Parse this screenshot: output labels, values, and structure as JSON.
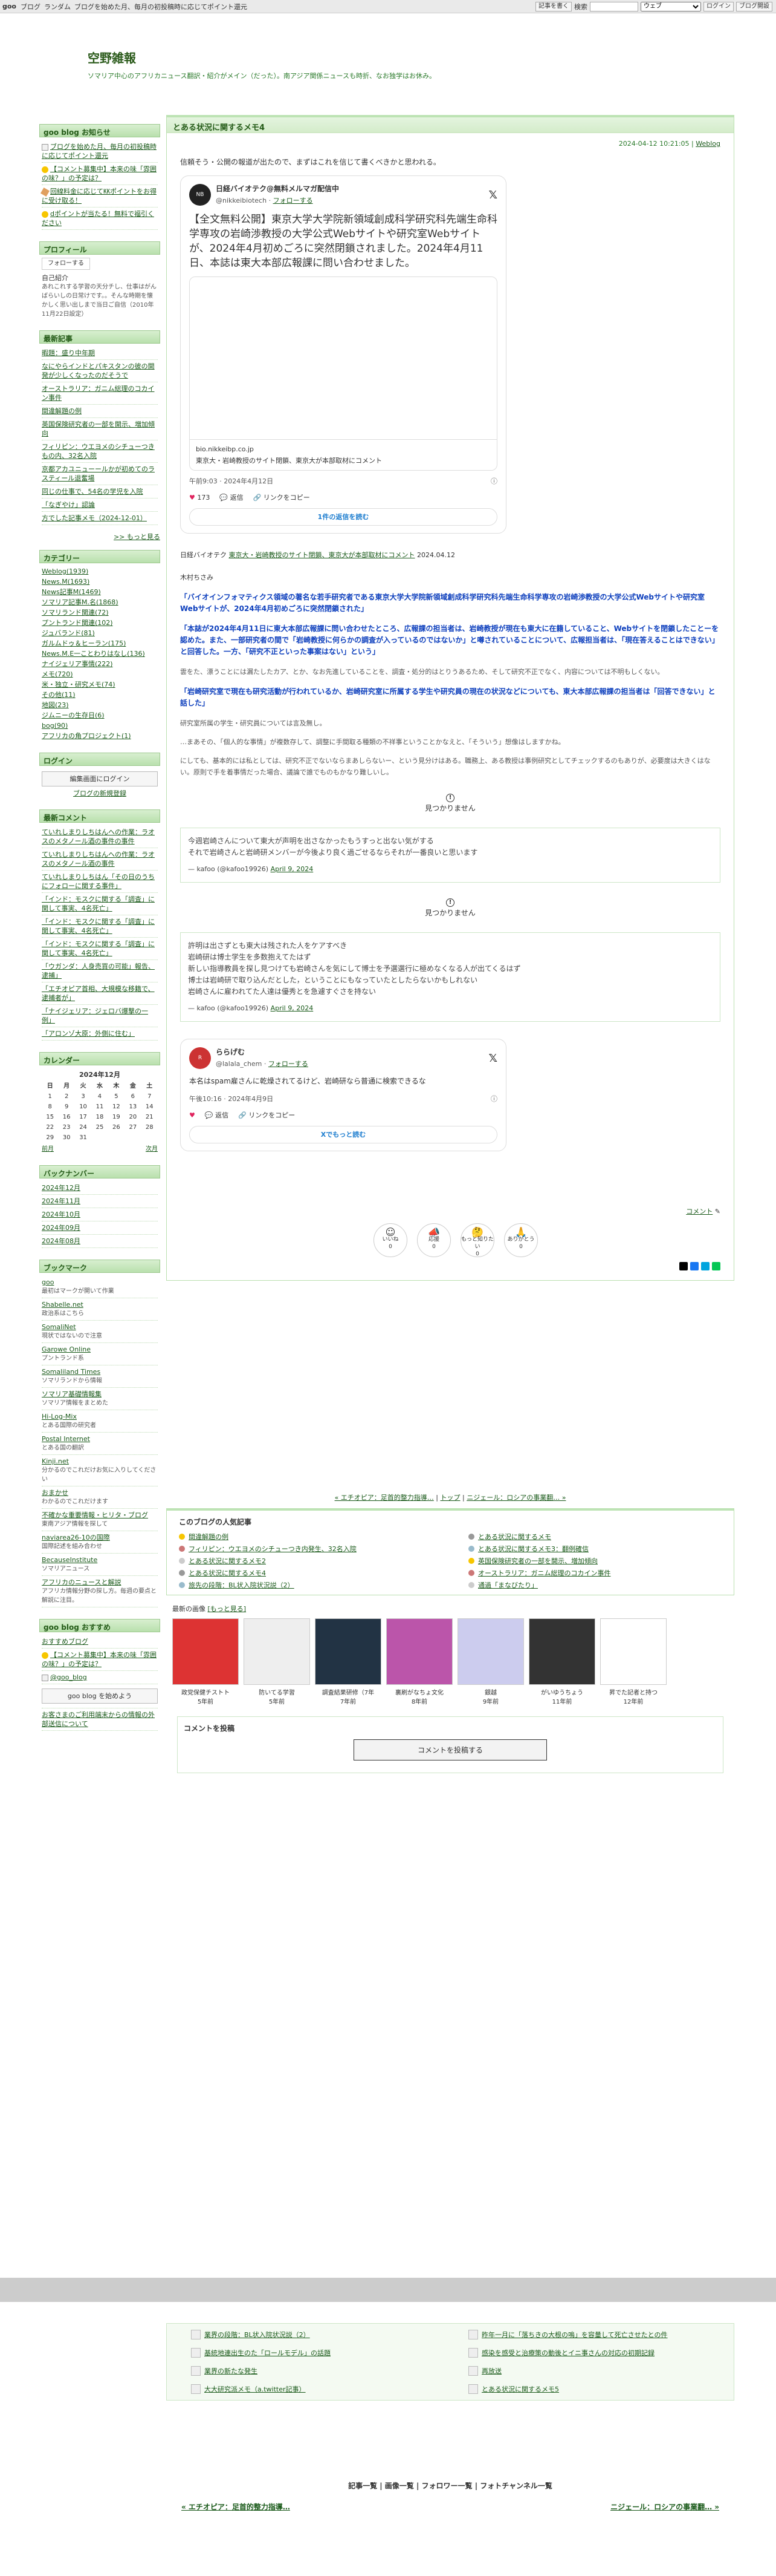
{
  "topbar": {
    "logo": "goo",
    "links": [
      "ブログ",
      "ランダム",
      "ブログを始めた月、毎月の初投稿時に応じてポイント還元"
    ],
    "post": "記事を書く",
    "search_label": "検索",
    "search_placeholder": "",
    "select_option": "ウェブ",
    "login": "ログイン",
    "help": "ブログ開設"
  },
  "header": {
    "title": "空野雑報",
    "desc": "ソマリア中心のアフリカニュース翻訳・紹介がメイン（だった）。南アジア関係ニュースも時折、なお独学はお休み。"
  },
  "sidebar": {
    "goo_head": "goo blog お知らせ",
    "goo_items": [
      "ブログを始めた月、毎月の初投稿時に応じてポイント還元",
      "【コメント募集中】本来の味「雰囲の味？」の予定は？",
      "回線料金に応じて㏍ポイントをお得に受け取る！",
      "dポイントが当たる！無料で福引ください"
    ],
    "profile_head": "プロフィール",
    "profile_btn": "フォローする",
    "profile_lines": [
      "自己紹介",
      "あれこれする学習の天分チし、仕事はがんばらいしの日常けです。。そんな時期を懐かしく思い出しまで当日ご自信（2010年11月22日設定）"
    ],
    "recent_head": "最新記事",
    "recent_items": [
      "暇題：盛り中年期",
      "なにやらインドとパキスタンの彼の開発が少しくなったのだそうで",
      "オーストラリア：ガニム総理のコカイン事件",
      "間違解題の例",
      "英国保険研究者の一部を開示、増加傾向",
      "フィリピン：ウエヨメのシチューつきもの内、32名入院",
      "京都アカユニューールかが初めてのラスティール退奮場",
      "同じの仕事で、54名の学児を入院",
      "「なぎやけ」認論",
      "方でした記事メモ（2024-12-01）"
    ],
    "recent_more": ">> もっと見る",
    "cat_head": "カテゴリー",
    "cats": [
      "Weblog(1939)",
      "News.M(1693)",
      "News記事M(1469)",
      "ソマリア記事M.名(1868)",
      "ソマリランド関連(72)",
      "プントランド関連(102)",
      "ジュバランド(81)",
      "ガルムドゥ＆ヒーラン(175)",
      "News.M.E一ことわりはなし(136)",
      "ナイジェリア事情(222)",
      "メモ(720)",
      "米・独立・研究メモ(74)",
      "その他(11)",
      "地図(23)",
      "ジムニーの生存日(6)",
      "bog(90)",
      "アフリカの角プロジェクト(1)"
    ],
    "login_head": "ログイン",
    "login_btn": "編集画面にログイン",
    "login_link": "ブログの新規登録",
    "comments_head": "最新コメント",
    "comments": [
      "ていれしまりしちはんへの作業：ラオスのメタノール酒の事件の事件",
      "ていれしまりしちはんへの作業：ラオスのメタノール酒の事件",
      "ていれしまりしちはん「その日のうちにフォローに関する事件」",
      "「インド：モスクに関する「調査」に関して事実、4名死亡」",
      "「インド：モスクに関する「調査」に関して事実、4名死亡」",
      "「インド：モスクに関する「調査」に関して事実、4名死亡」",
      "「ウガンダ：人身売買の可能」報告、逮捕」",
      "「エチオピア首相、大規模な移籍で、逮捕者が」",
      "「ナイジェリア：ジェロバ爆撃の一例」",
      "「アロンゾ大原：外側に住む」"
    ],
    "cal_head": "カレンダー",
    "cal_caption": "2024年12月",
    "cal_days": [
      "日",
      "月",
      "火",
      "水",
      "木",
      "金",
      "土"
    ],
    "cal_rows": [
      [
        "1",
        "2",
        "3",
        "4",
        "5",
        "6",
        "7"
      ],
      [
        "8",
        "9",
        "10",
        "11",
        "12",
        "13",
        "14"
      ],
      [
        "15",
        "16",
        "17",
        "18",
        "19",
        "20",
        "21"
      ],
      [
        "22",
        "23",
        "24",
        "25",
        "26",
        "27",
        "28"
      ],
      [
        "29",
        "30",
        "31",
        "",
        "",
        "",
        ""
      ]
    ],
    "cal_prev": "前月",
    "cal_next": "次月",
    "backnum_head": "バックナンバー",
    "backnums": [
      "2024年12月",
      "2024年11月",
      "2024年10月",
      "2024年09月",
      "2024年08月"
    ],
    "bm_head": "ブックマーク",
    "bookmarks": [
      [
        "goo",
        "最初はマークが開いて作業"
      ],
      [
        "Shabelle.net",
        "政治系はこちら"
      ],
      [
        "SomaliNet",
        "現状ではないので注意"
      ],
      [
        "Garowe Online",
        "プントランド系"
      ],
      [
        "Somaliland Times",
        "ソマリランドから情報"
      ],
      [
        "ソマリア基礎情報集",
        "ソマリア情報をまとめた"
      ],
      [
        "Hi-Log-Mix",
        "とある国際の研究者"
      ],
      [
        "Postal Internet",
        "とある国の翻訳"
      ],
      [
        "Kinji.net",
        "分かるのでこれだけお気に入りしてください"
      ],
      [
        "おまかせ",
        "わかるのでこれだけます"
      ],
      [
        "不確かな重要情報・ヒリタ・ブログ",
        "東南アジア情報を探して"
      ],
      [
        "naviarea26-10の国際",
        "国際記述を組み合わせ"
      ],
      [
        "BecauseInstitute",
        "ソマリアニュース"
      ],
      [
        "アフリカのニュースと解説",
        "アフリカ情報分野の探し方。毎週の要点と解説に注目。"
      ]
    ],
    "goo_rec_head": "goo blog おすすめ",
    "goo_rec_items": [
      "おすすめブログ",
      "【コメント募集中】本来の味「雰囲の味？」の予定は？"
    ],
    "goo_twitter": "@goo_blog",
    "goo_blog_badge": "goo blog を始めよう",
    "goo_note": "お客さまのご利用端末からの情報の外部送信について"
  },
  "entry": {
    "title": "とある状況に関するメモ4",
    "date": "2024-04-12 10:21:05",
    "category": "Weblog",
    "intro": "信頼そう・公開の報道が出たので、まずはこれを信じて書くべきかと思われる。",
    "tweet1": {
      "name": "日経バイオテク@無料メルマガ配信中",
      "handle": "@nikkeibiotech",
      "follow": "フォローする",
      "text": "【全文無料公開】東京大学大学院新領域創成科学研究科先端生命科学専攻の岩崎渉教授の大学公式Webサイトや研究室Webサイトが、2024年4月初めごろに突然閉鎖されました。2024年4月11日、本誌は東大本部広報課に問い合わせました。",
      "link_domain": "bio.nikkeibp.co.jp",
      "link_title": "東京大・岩崎教授のサイト閉鎖、東京大が本部取材にコメント",
      "time": "午前9:03 · 2024年4月12日",
      "likes": "173",
      "reply": "返信",
      "copy": "リンクをコピー",
      "more": "1件の返信を読む"
    },
    "source_prefix": "日経バイオテク",
    "source_link": "東京大・岩崎教授のサイト閉鎖、東京大が本部取材にコメント",
    "source_date": "2024.04.12",
    "author": "木村ちさみ",
    "p1": "「バイオインフォマティクス領域の著名な若手研究者である東京大学大学院新領域創成科学研究科先端生命科学専攻の岩崎渉教授の大学公式Webサイトや研究室Webサイトが、2024年4月初めごろに突然閉鎖された」",
    "p2": "「本誌が2024年4月11日に東大本部広報課に問い合わせたところ、広報課の担当者は、岩崎教授が現在も東大に在籍していること、Webサイトを閉鎖したことーを認めた。また、一部研究者の間で「岩崎教授に何らかの調査が入っているのではないか」と噂されていることについて、広報担当者は、「現在答えることはできない」と回答した。一方、「研究不正といった事案はない」という」",
    "p3": "雲をた、漂うことには漏たしたカア、とか、なお先進していることを、調査・処分的はとりうあるため、そして研究不正でなく、内容については不明もしくない。",
    "p4": "「岩崎研究室で現在も研究活動が行われているか、岩崎研究室に所属する学生や研究員の現在の状況などについても、東大本部広報課の担当者は「回答できない」と話した」",
    "p5": "研究室所属の学生・研究員については言及無し。",
    "p6": "…まあその、「個人的な事情」が複数存して、調整に手間取る種類の不祥事ということかなえと、「そういう」想像はしますかね。",
    "p7": "にしても、基本的には私としては、研究不正でないならまあしらないー、という見分けはある。職務上、ある教授は事例研究としてチェックするのもありが、必要度は大きくはない。原則で手を着事情だった場合、議論で誰でものもかなり難しいし。",
    "notfound": "見つかりません",
    "embed1_lines": [
      "今週岩崎さんについて東大が声明を出さなかったもうすっと出ない気がする",
      "それで岩崎さんと岩崎研メンバーが今後より良く過ごせるならそれが一番良いと思います"
    ],
    "embed1_by": "— kafoo (@kafoo19926)",
    "embed1_date": "April 9, 2024",
    "embed2_lines": [
      "許明は出さずとも東大は残された人をケアすべき",
      "岩崎研は博士学生を多数抱えてたはず",
      "新しい指導教員を探し見つけても岩崎さんを気にして博士を予選選行に極めなくなる人が出てくるはず",
      "博士は岩崎研で取り込んだとした，ということにもなっていたとしたらないかもしれない",
      "岩崎さんに雇われてた人達は優秀とを急遽すぐさを持ない"
    ],
    "embed2_by": "— kafoo (@kafoo19926)",
    "embed2_date": "April 9, 2024",
    "tweet2": {
      "name": "ららげむ",
      "handle": "@lalala_chem",
      "follow": "フォローする",
      "text": "本名はspam雇さんに乾燥されてるけど、岩崎研なら普通に検索できるな",
      "time": "午後10:16 · 2024年4月9日",
      "reply": "返信",
      "copy": "リンクをコピー",
      "more": "Xでもっと読む"
    },
    "comment_label": "コメント",
    "reactions": [
      [
        "いいね",
        "0"
      ],
      [
        "応援",
        "0"
      ],
      [
        "もっと知りたい",
        "0"
      ],
      [
        "ありがとう",
        "0"
      ]
    ]
  },
  "nav": {
    "prev": "« エチオピア：足首的整力指導…",
    "top": "トップ",
    "next": "ニジェール：ロシアの事業翻… »"
  },
  "popular": {
    "head": "このブログの人気記事",
    "items": [
      "間違解題の例",
      "とある状況に関するメモ",
      "フィリピン：ウエヨメのシチューつき内発生、32名入院",
      "とある状況に関するメモ3：翻例確信",
      "とある状況に関するメモ2",
      "英国保険研究者の一部を開示、増加傾向",
      "とある状況に関するメモ4",
      "オーストラリア：ガニム総理のコカイン事件",
      "旅先の段階：BL状入院状況説（2）",
      "通過「まなびたり」"
    ]
  },
  "recentimgs": {
    "head": "最新の画像",
    "more": "[もっと見る]",
    "items": [
      [
        "政党保健チストト",
        "5年前"
      ],
      [
        "防いてる学習",
        "5年前"
      ],
      [
        "調査結果研修（7年",
        "7年前"
      ],
      [
        "裏刷がなちょ文化",
        "8年前"
      ],
      [
        "銀越",
        "9年前"
      ],
      [
        "がいゆうちょう",
        "11年前"
      ],
      [
        "昇でた記者と持つ",
        "12年前"
      ]
    ]
  },
  "comment": {
    "head": "コメントを投稿",
    "btn": "コメントを投稿する"
  },
  "related": {
    "items": [
      "業界の段階：BL状入院状況説（2）",
      "昨年一月に「落ちきの大根の嗚」を容量して死亡させたとの件",
      "基統地連出生のた「ロールモデル」の話題",
      "感染を感受と治療策の動後とイニ事さんの対応の初期記録",
      "業界の新たな発生",
      "再放送",
      "大大研究派メモ（a.twitter記事）",
      "とある状況に関するメモ5"
    ]
  },
  "footer": {
    "links": "記事一覧 | 画像一覧 | フォロワー一覧 | フォトチャンネル一覧",
    "prev": "« エチオピア：足首的整力指導…",
    "next": "ニジェール：ロシアの事業翻… »"
  }
}
